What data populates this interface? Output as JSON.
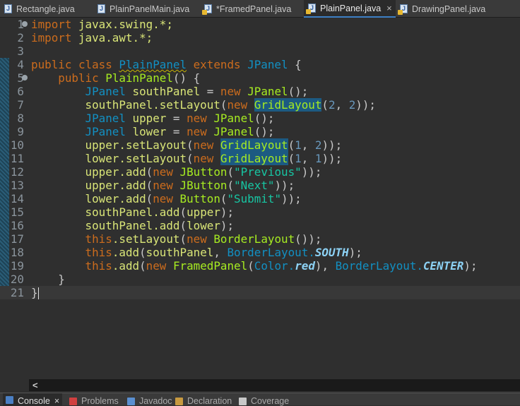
{
  "tabs": [
    {
      "label": "Rectangle.java",
      "warn": false,
      "active": false
    },
    {
      "label": "PlainPanelMain.java",
      "warn": false,
      "active": false
    },
    {
      "label": "*FramedPanel.java",
      "warn": true,
      "active": false
    },
    {
      "label": "PlainPanel.java",
      "warn": true,
      "active": true,
      "close": "×"
    },
    {
      "label": "DrawingPanel.java",
      "warn": true,
      "active": false
    }
  ],
  "editor": {
    "current_line": 21,
    "lines": [
      {
        "n": "1",
        "fold": true,
        "t": [
          [
            "kw",
            "import"
          ],
          [
            "id",
            " javax.swing.*;"
          ]
        ]
      },
      {
        "n": "2",
        "t": [
          [
            "kw",
            "import"
          ],
          [
            "id",
            " java.awt.*;"
          ]
        ]
      },
      {
        "n": "3",
        "t": []
      },
      {
        "n": "4",
        "t": [
          [
            "kw",
            "public class "
          ],
          [
            "und",
            "PlainPanel"
          ],
          [
            "kw",
            " extends "
          ],
          [
            "ty",
            "JPanel "
          ],
          [
            "pu",
            "{"
          ]
        ]
      },
      {
        "n": "5",
        "fold": true,
        "t": [
          [
            "kw",
            "    public "
          ],
          [
            "fn",
            "PlainPanel"
          ],
          [
            "pu",
            "() {"
          ]
        ]
      },
      {
        "n": "6",
        "t": [
          [
            "ty",
            "        JPanel "
          ],
          [
            "id",
            "southPanel "
          ],
          [
            "pu",
            "= "
          ],
          [
            "kw",
            "new "
          ],
          [
            "fn",
            "JPanel"
          ],
          [
            "pu",
            "();"
          ]
        ]
      },
      {
        "n": "7",
        "t": [
          [
            "id",
            "        southPanel.setLayout"
          ],
          [
            "pu",
            "("
          ],
          [
            "kw",
            "new "
          ],
          [
            "hl",
            "GridLayout"
          ],
          [
            "pu",
            "("
          ],
          [
            "nu",
            "2"
          ],
          [
            "pu",
            ", "
          ],
          [
            "nu",
            "2"
          ],
          [
            "pu",
            "));"
          ]
        ]
      },
      {
        "n": "8",
        "t": [
          [
            "ty",
            "        JPanel "
          ],
          [
            "id",
            "upper "
          ],
          [
            "pu",
            "= "
          ],
          [
            "kw",
            "new "
          ],
          [
            "fn",
            "JPanel"
          ],
          [
            "pu",
            "();"
          ]
        ]
      },
      {
        "n": "9",
        "t": [
          [
            "ty",
            "        JPanel "
          ],
          [
            "id",
            "lower "
          ],
          [
            "pu",
            "= "
          ],
          [
            "kw",
            "new "
          ],
          [
            "fn",
            "JPanel"
          ],
          [
            "pu",
            "();"
          ]
        ]
      },
      {
        "n": "10",
        "t": [
          [
            "id",
            "        upper.setLayout"
          ],
          [
            "pu",
            "("
          ],
          [
            "kw",
            "new "
          ],
          [
            "hl",
            "GridLayout"
          ],
          [
            "pu",
            "("
          ],
          [
            "nu",
            "1"
          ],
          [
            "pu",
            ", "
          ],
          [
            "nu",
            "2"
          ],
          [
            "pu",
            "));"
          ]
        ]
      },
      {
        "n": "11",
        "t": [
          [
            "id",
            "        lower.setLayout"
          ],
          [
            "pu",
            "("
          ],
          [
            "kw",
            "new "
          ],
          [
            "hl",
            "GridLayout"
          ],
          [
            "pu",
            "("
          ],
          [
            "nu",
            "1"
          ],
          [
            "pu",
            ", "
          ],
          [
            "nu",
            "1"
          ],
          [
            "pu",
            "));"
          ]
        ]
      },
      {
        "n": "12",
        "t": [
          [
            "id",
            "        upper.add"
          ],
          [
            "pu",
            "("
          ],
          [
            "kw",
            "new "
          ],
          [
            "fn",
            "JButton"
          ],
          [
            "pu",
            "("
          ],
          [
            "st",
            "\"Previous\""
          ],
          [
            "pu",
            "));"
          ]
        ]
      },
      {
        "n": "13",
        "t": [
          [
            "id",
            "        upper.add"
          ],
          [
            "pu",
            "("
          ],
          [
            "kw",
            "new "
          ],
          [
            "fn",
            "JButton"
          ],
          [
            "pu",
            "("
          ],
          [
            "st",
            "\"Next\""
          ],
          [
            "pu",
            "));"
          ]
        ]
      },
      {
        "n": "14",
        "t": [
          [
            "id",
            "        lower.add"
          ],
          [
            "pu",
            "("
          ],
          [
            "kw",
            "new "
          ],
          [
            "fn",
            "Button"
          ],
          [
            "pu",
            "("
          ],
          [
            "st",
            "\"Submit\""
          ],
          [
            "pu",
            "));"
          ]
        ]
      },
      {
        "n": "15",
        "t": [
          [
            "id",
            "        southPanel.add"
          ],
          [
            "pu",
            "("
          ],
          [
            "id",
            "upper"
          ],
          [
            "pu",
            ");"
          ]
        ]
      },
      {
        "n": "16",
        "t": [
          [
            "id",
            "        southPanel.add"
          ],
          [
            "pu",
            "("
          ],
          [
            "id",
            "lower"
          ],
          [
            "pu",
            ");"
          ]
        ]
      },
      {
        "n": "17",
        "t": [
          [
            "kw",
            "        this"
          ],
          [
            "id",
            ".setLayout"
          ],
          [
            "pu",
            "("
          ],
          [
            "kw",
            "new "
          ],
          [
            "fn",
            "BorderLayout"
          ],
          [
            "pu",
            "());"
          ]
        ]
      },
      {
        "n": "18",
        "t": [
          [
            "kw",
            "        this"
          ],
          [
            "id",
            ".add"
          ],
          [
            "pu",
            "("
          ],
          [
            "id",
            "southPanel"
          ],
          [
            "pu",
            ", "
          ],
          [
            "ty",
            "BorderLayout."
          ],
          [
            "cn",
            "SOUTH"
          ],
          [
            "pu",
            ");"
          ]
        ]
      },
      {
        "n": "19",
        "t": [
          [
            "kw",
            "        this"
          ],
          [
            "id",
            ".add"
          ],
          [
            "pu",
            "("
          ],
          [
            "kw",
            "new "
          ],
          [
            "fn",
            "FramedPanel"
          ],
          [
            "pu",
            "("
          ],
          [
            "ty",
            "Color."
          ],
          [
            "cn",
            "red"
          ],
          [
            "pu",
            "), "
          ],
          [
            "ty",
            "BorderLayout."
          ],
          [
            "cn",
            "CENTER"
          ],
          [
            "pu",
            ");"
          ]
        ]
      },
      {
        "n": "20",
        "t": [
          [
            "pu",
            "    }"
          ]
        ]
      },
      {
        "n": "21",
        "t": [
          [
            "pu",
            "}"
          ]
        ]
      }
    ]
  },
  "scroll_left": "<",
  "bottom_tabs": [
    {
      "label": "Console",
      "close": "×",
      "active": true,
      "color": "#4a7fc4"
    },
    {
      "label": "Problems",
      "color": "#d04040"
    },
    {
      "label": "Javadoc",
      "color": "#5a8fd0"
    },
    {
      "label": "Declaration",
      "color": "#c89a40"
    },
    {
      "label": "Coverage",
      "color": "#c8c8c8"
    }
  ]
}
